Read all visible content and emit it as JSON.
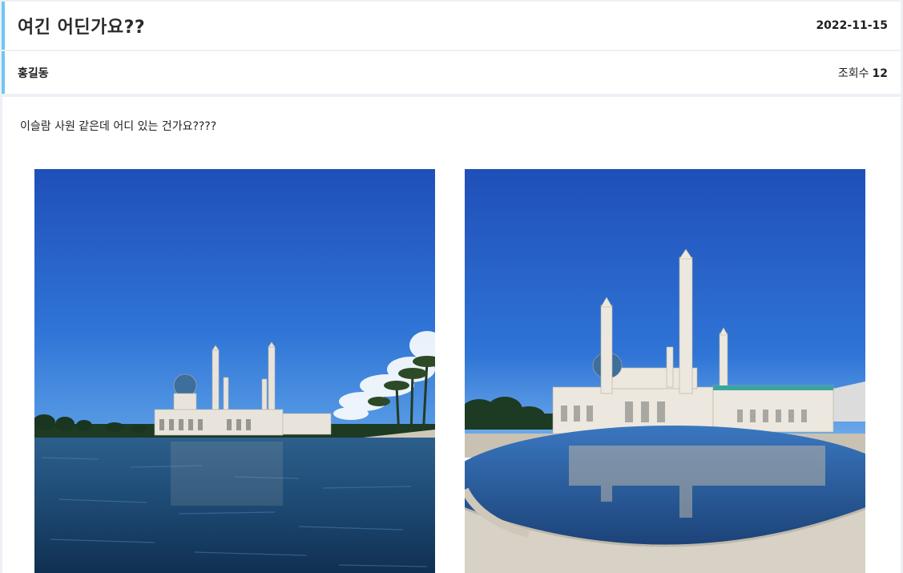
{
  "post": {
    "title": "여긴 어딘가요??",
    "date": "2022-11-15",
    "author": "홍길동",
    "views_label": "조회수",
    "views_count": "12",
    "body": "이슬람 사원 같은데 어디 있는 건가요????"
  },
  "colors": {
    "accent": "#6ec6f0",
    "sky": "#2f6fd0",
    "water": "#1f4d78"
  },
  "images": [
    {
      "name": "mosque-photo-waterfront"
    },
    {
      "name": "mosque-photo-reflection-pool"
    }
  ]
}
